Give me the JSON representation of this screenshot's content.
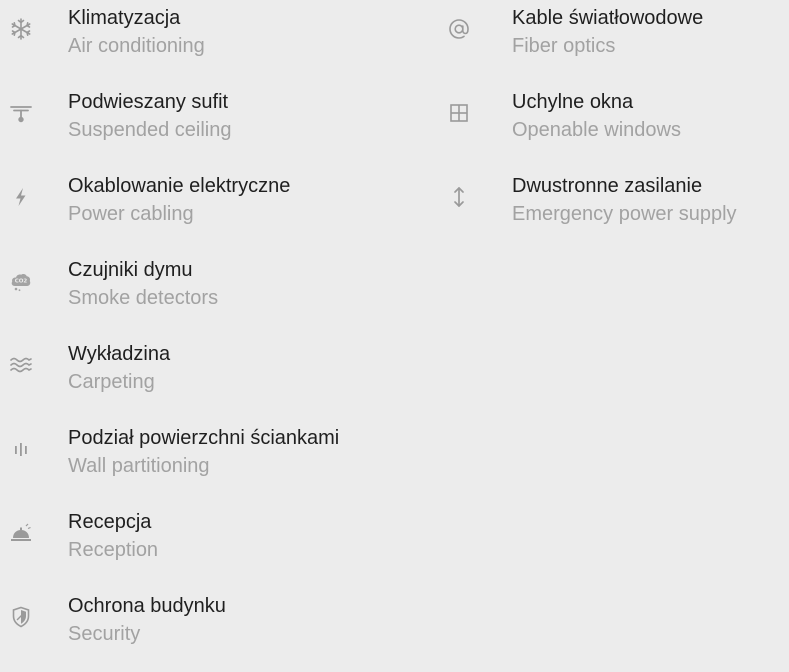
{
  "amenities_left": [
    {
      "title": "Klimatyzacja",
      "subtitle": "Air conditioning",
      "icon": "snowflake-icon"
    },
    {
      "title": "Podwieszany sufit",
      "subtitle": "Suspended ceiling",
      "icon": "ceiling-lamp-icon"
    },
    {
      "title": "Okablowanie elektryczne",
      "subtitle": "Power cabling",
      "icon": "lightning-icon"
    },
    {
      "title": "Czujniki dymu",
      "subtitle": "Smoke detectors",
      "icon": "smoke-cloud-icon"
    },
    {
      "title": "Wykładzina",
      "subtitle": "Carpeting",
      "icon": "waves-icon"
    },
    {
      "title": "Podział powierzchni ściankami",
      "subtitle": "Wall partitioning",
      "icon": "partition-bars-icon"
    },
    {
      "title": "Recepcja",
      "subtitle": "Reception",
      "icon": "service-bell-icon"
    },
    {
      "title": "Ochrona budynku",
      "subtitle": "Security",
      "icon": "shield-icon"
    }
  ],
  "amenities_right": [
    {
      "title": "Kable światłowodowe",
      "subtitle": "Fiber optics",
      "icon": "at-sign-icon"
    },
    {
      "title": "Uchylne okna",
      "subtitle": "Openable windows",
      "icon": "window-icon"
    },
    {
      "title": "Dwustronne zasilanie",
      "subtitle": "Emergency power supply",
      "icon": "vertical-arrows-icon"
    }
  ],
  "colors": {
    "background": "#ececec",
    "title_text": "#1f1f1f",
    "subtitle_text": "#a2a2a2",
    "icon": "#9a9a9a"
  }
}
